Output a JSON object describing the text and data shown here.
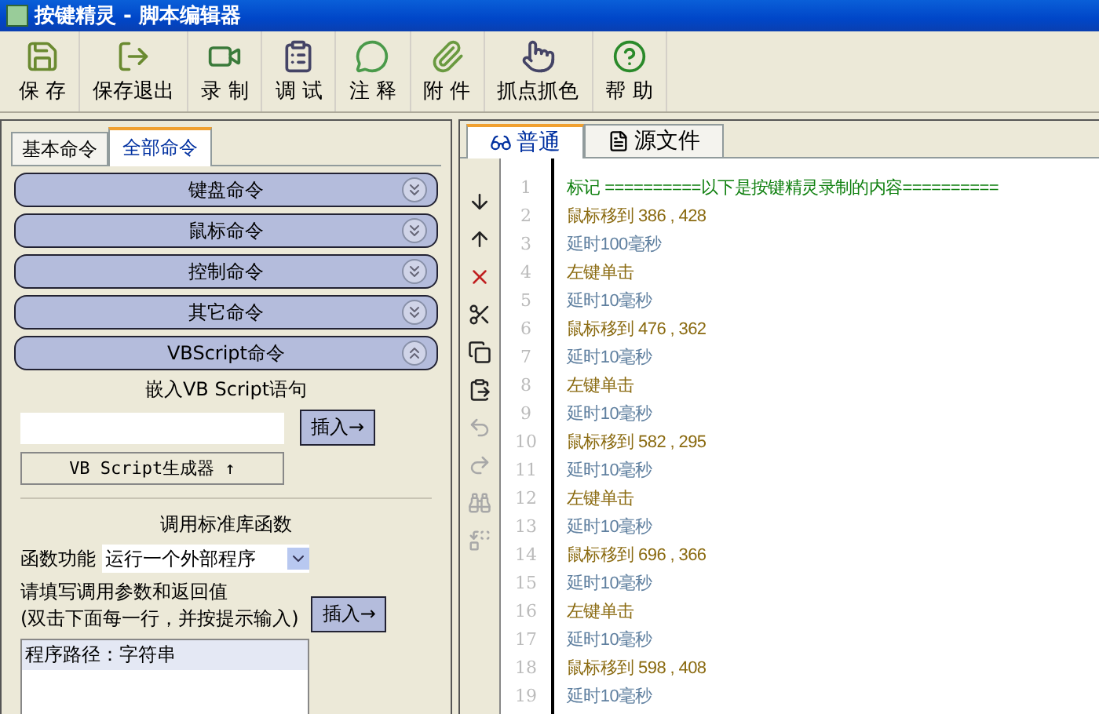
{
  "window": {
    "title": "按键精灵 - 脚本编辑器"
  },
  "toolbar": [
    {
      "label": "保 存"
    },
    {
      "label": "保存退出"
    },
    {
      "label": "录 制"
    },
    {
      "label": "调 试"
    },
    {
      "label": "注 释"
    },
    {
      "label": "附 件"
    },
    {
      "label": "抓点抓色"
    },
    {
      "label": "帮 助"
    }
  ],
  "left_tabs": [
    {
      "label": "基本命令",
      "selected": false
    },
    {
      "label": "全部命令",
      "selected": true
    }
  ],
  "sections": [
    {
      "label": "键盘命令",
      "expanded": false
    },
    {
      "label": "鼠标命令",
      "expanded": false
    },
    {
      "label": "控制命令",
      "expanded": false
    },
    {
      "label": "其它命令",
      "expanded": false
    },
    {
      "label": "VBScript命令",
      "expanded": true
    }
  ],
  "vbscript": {
    "heading": "嵌入VB Script语句",
    "insert_button": "插入→",
    "generator_button": "VB Script生成器 ↑"
  },
  "library": {
    "heading": "调用标准库函数",
    "function_label": "函数功能",
    "function_value": "运行一个外部程序",
    "params_label": "请填写调用参数和返回值",
    "params_hint": "(双击下面每一行，并按提示输入)",
    "insert_button": "插入→",
    "params": [
      {
        "text": "程序路径：字符串",
        "selected": true
      }
    ]
  },
  "editor_tabs": [
    {
      "label": "普通",
      "selected": true
    },
    {
      "label": "源文件",
      "selected": false
    }
  ],
  "side_tools": [
    {
      "disabled": false
    },
    {
      "disabled": false
    },
    {
      "disabled": false
    },
    {
      "disabled": false
    },
    {
      "disabled": false
    },
    {
      "disabled": false
    },
    {
      "disabled": true
    },
    {
      "disabled": true
    },
    {
      "disabled": true
    },
    {
      "disabled": true
    }
  ],
  "lines": [
    {
      "number": "1",
      "text": "标记 ==========以下是按键精灵录制的内容==========",
      "kind": "comment"
    },
    {
      "number": "2",
      "text": "鼠标移到 386 , 428",
      "kind": "action"
    },
    {
      "number": "3",
      "text": "延时100毫秒",
      "kind": "delay"
    },
    {
      "number": "4",
      "text": "左键单击",
      "kind": "action"
    },
    {
      "number": "5",
      "text": "延时10毫秒",
      "kind": "delay"
    },
    {
      "number": "6",
      "text": "鼠标移到 476 , 362",
      "kind": "action"
    },
    {
      "number": "7",
      "text": "延时10毫秒",
      "kind": "delay"
    },
    {
      "number": "8",
      "text": "左键单击",
      "kind": "action"
    },
    {
      "number": "9",
      "text": "延时10毫秒",
      "kind": "delay"
    },
    {
      "number": "10",
      "text": "鼠标移到 582 , 295",
      "kind": "action"
    },
    {
      "number": "11",
      "text": "延时10毫秒",
      "kind": "delay"
    },
    {
      "number": "12",
      "text": "左键单击",
      "kind": "action"
    },
    {
      "number": "13",
      "text": "延时10毫秒",
      "kind": "delay"
    },
    {
      "number": "14",
      "text": "鼠标移到 696 , 366",
      "kind": "action"
    },
    {
      "number": "15",
      "text": "延时10毫秒",
      "kind": "delay"
    },
    {
      "number": "16",
      "text": "左键单击",
      "kind": "action"
    },
    {
      "number": "17",
      "text": "延时10毫秒",
      "kind": "delay"
    },
    {
      "number": "18",
      "text": "鼠标移到 598 , 408",
      "kind": "action"
    },
    {
      "number": "19",
      "text": "延时10毫秒",
      "kind": "delay"
    }
  ]
}
